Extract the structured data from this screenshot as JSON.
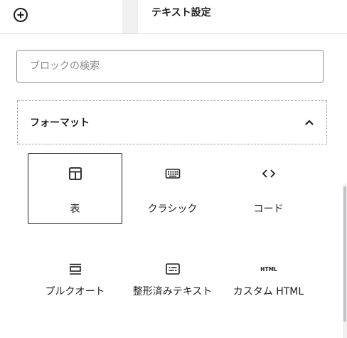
{
  "topbar": {
    "settings_tab": "テキスト設定",
    "add_icon": "plus-circle-icon"
  },
  "search": {
    "placeholder": "ブロックの検索"
  },
  "category": {
    "title": "フォーマット",
    "expanded": true,
    "toggle_icon": "chevron-up-icon"
  },
  "blocks": [
    {
      "label": "表",
      "icon": "table-icon",
      "selected": true
    },
    {
      "label": "クラシック",
      "icon": "keyboard-icon",
      "selected": false
    },
    {
      "label": "コード",
      "icon": "code-icon",
      "selected": false
    },
    {
      "label": "プルクオート",
      "icon": "pullquote-icon",
      "selected": false
    },
    {
      "label": "整形済みテキスト",
      "icon": "preformatted-icon",
      "selected": false
    },
    {
      "label": "カスタム HTML",
      "icon": "html-icon",
      "selected": false
    }
  ],
  "colors": {
    "text": "#1e1e1e",
    "border": "#8c8f94",
    "placeholder": "#8a8a8a"
  }
}
